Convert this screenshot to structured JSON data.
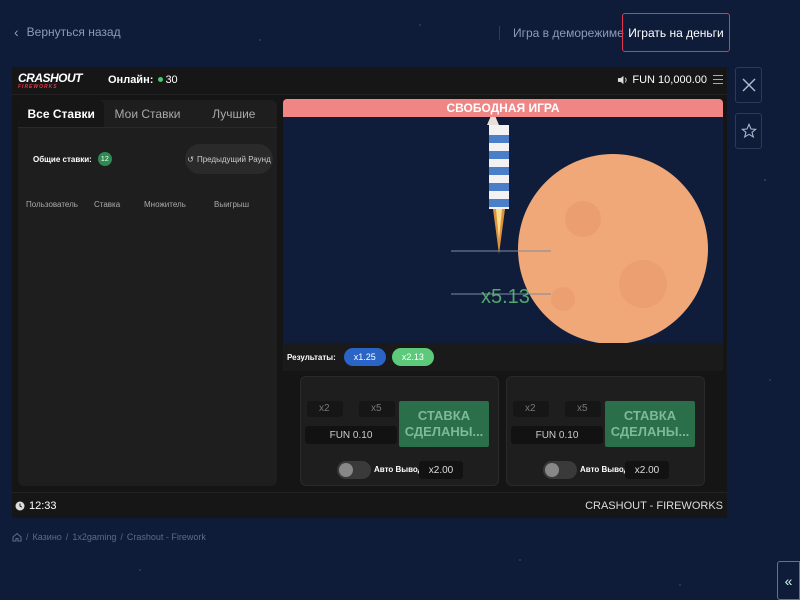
{
  "top": {
    "back_label": "Вернуться назад",
    "demo_label": "Игра в деморежиме",
    "real_label": "Играть на деньги"
  },
  "game": {
    "logo_main": "CRASHOUT",
    "logo_sub": "FIREWORKS",
    "online_label": "Онлайн:",
    "online_count": "30",
    "balance": "FUN 10,000.00",
    "tabs": [
      {
        "label": "Все Ставки",
        "active": true
      },
      {
        "label": "Мои Ставки",
        "active": false
      },
      {
        "label": "Лучшие",
        "active": false
      }
    ],
    "total_label": "Общие ставки:",
    "total_count": "12",
    "prev_round_label": "Предыдущий Раунд",
    "columns": [
      "Пользователь",
      "Ставка",
      "Множитель",
      "Выигрыш"
    ],
    "free_banner": "СВОБОДНАЯ ИГРА",
    "multiplier": "x5.13",
    "results_label": "Результаты:",
    "results": [
      {
        "value": "x1.25",
        "color": "#2a64c6"
      },
      {
        "value": "x2.13",
        "color": "#5dc97a"
      }
    ],
    "bet_panels": [
      {
        "quick1": "x2",
        "quick2": "x5",
        "amount": "FUN 0.10",
        "button": "СТАВКА СДЕЛАНЫ...",
        "auto_label": "Авто Вывод",
        "auto_value": "x2.00"
      },
      {
        "quick1": "x2",
        "quick2": "x5",
        "amount": "FUN 0.10",
        "button": "СТАВКА СДЕЛАНЫ...",
        "auto_label": "Авто Вывод",
        "auto_value": "x2.00"
      }
    ],
    "time": "12:33",
    "footer_title": "CRASHOUT - FIREWORKS"
  },
  "breadcrumb": [
    "Казино",
    "1x2gaming",
    "Crashout - Firework"
  ],
  "colors": {
    "accent_red": "#e0354a",
    "banner": "#f08585",
    "button_green": "#2a6e4a",
    "moon": "#f0a878"
  }
}
